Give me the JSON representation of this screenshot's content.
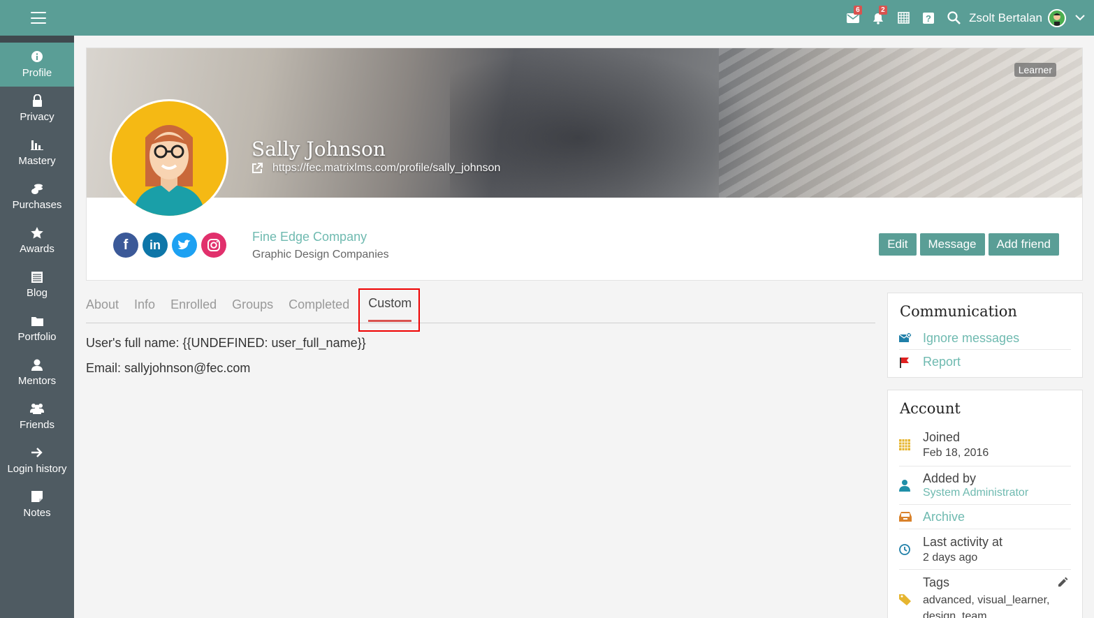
{
  "topbar": {
    "mail_badge": "6",
    "notif_badge": "2",
    "user_name": "Zsolt Bertalan"
  },
  "sidebar": {
    "items": [
      {
        "label": "Profile",
        "icon": "info-icon",
        "active": true
      },
      {
        "label": "Privacy",
        "icon": "lock-icon"
      },
      {
        "label": "Mastery",
        "icon": "bar-chart-icon"
      },
      {
        "label": "Purchases",
        "icon": "coins-icon"
      },
      {
        "label": "Awards",
        "icon": "star-icon"
      },
      {
        "label": "Blog",
        "icon": "blog-icon"
      },
      {
        "label": "Portfolio",
        "icon": "folder-icon"
      },
      {
        "label": "Mentors",
        "icon": "user-icon"
      },
      {
        "label": "Friends",
        "icon": "users-icon"
      },
      {
        "label": "Login history",
        "icon": "arrow-right-icon"
      },
      {
        "label": "Notes",
        "icon": "note-icon"
      }
    ]
  },
  "profile": {
    "role": "Learner",
    "name": "Sally Johnson",
    "url": "https://fec.matrixlms.com/profile/sally_johnson",
    "company": "Fine Edge Company",
    "company_type": "Graphic Design Companies",
    "socials": [
      "f",
      "in"
    ],
    "actions": {
      "edit": "Edit",
      "message": "Message",
      "add_friend": "Add friend"
    }
  },
  "tabs": [
    "About",
    "Info",
    "Enrolled",
    "Groups",
    "Completed",
    "Custom"
  ],
  "active_tab": "Custom",
  "custom": {
    "full_name_line": "User's full name: {{UNDEFINED: user_full_name}}",
    "email_line": "Email: sallyjohnson@fec.com"
  },
  "communication": {
    "title": "Communication",
    "ignore": "Ignore messages",
    "report": "Report"
  },
  "account": {
    "title": "Account",
    "joined_label": "Joined",
    "joined_value": "Feb 18, 2016",
    "added_by_label": "Added by",
    "added_by_value": "System Administrator",
    "archive": "Archive",
    "last_activity_label": "Last activity at",
    "last_activity_value": "2 days ago",
    "tags_label": "Tags",
    "tags_value": "advanced, visual_learner, design_team"
  },
  "colors": {
    "brand": "#5a9e96",
    "sidebar": "#4f5b62",
    "link": "#6fbab0",
    "badge": "#d9534f"
  }
}
